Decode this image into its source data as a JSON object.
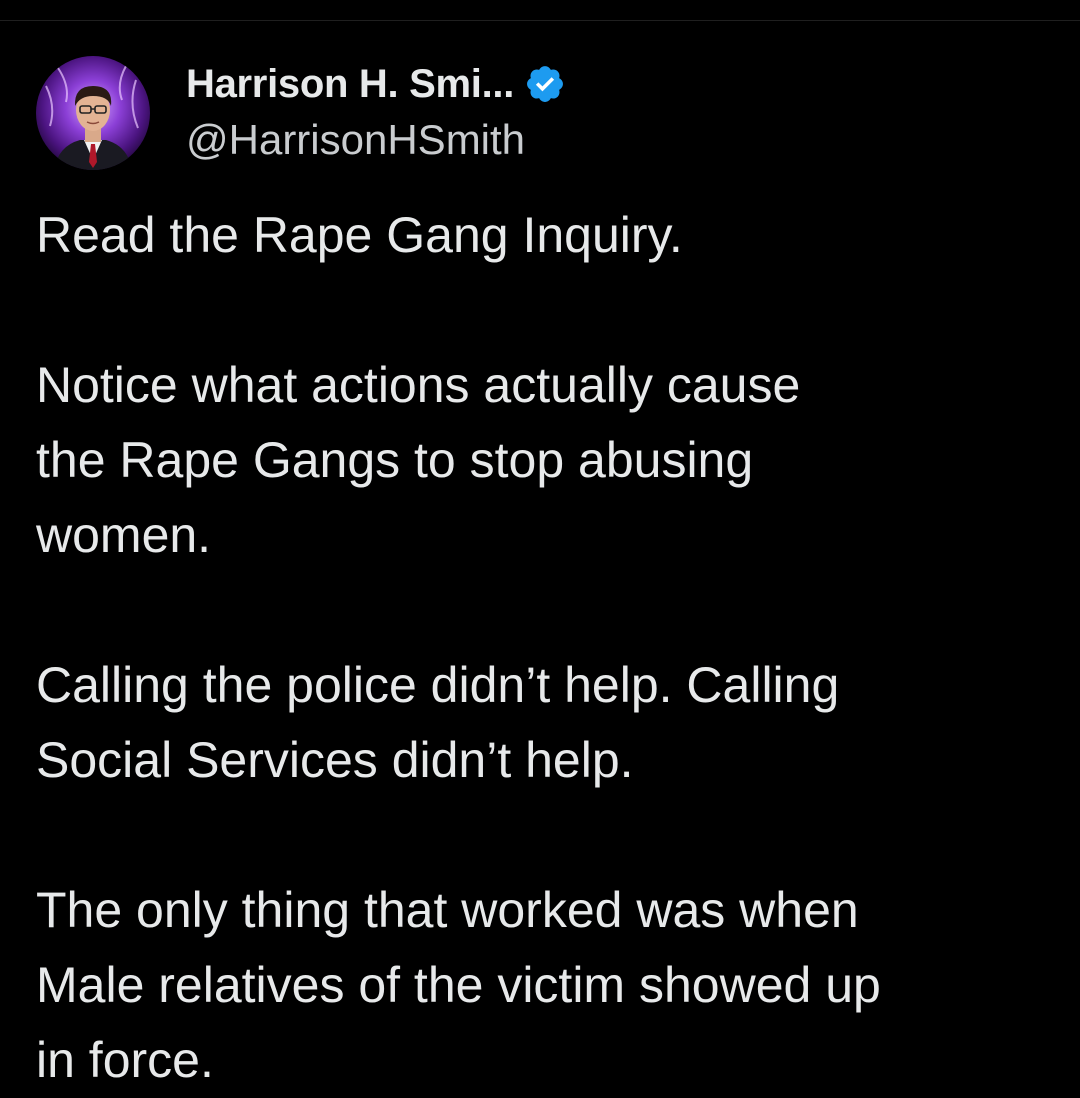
{
  "author": {
    "display_name": "Harrison H. Smi...",
    "handle": "@HarrisonHSmith",
    "verified": true,
    "avatar_icon": "avatar-portrait-purple-aura",
    "verified_icon": "verified-badge-icon",
    "verified_color": "#1d9bf0"
  },
  "tweet": {
    "paragraphs": [
      "Read the Rape Gang Inquiry.",
      "Notice what actions actually cause\nthe Rape Gangs to stop abusing\nwomen.",
      "Calling the police didn’t help. Calling\nSocial Services didn’t help.",
      "The only thing that worked was when\nMale relatives of the victim showed up\nin force."
    ]
  },
  "colors": {
    "background": "#000000",
    "text": "#e7e9ea",
    "secondary_text": "#c9cccf"
  }
}
